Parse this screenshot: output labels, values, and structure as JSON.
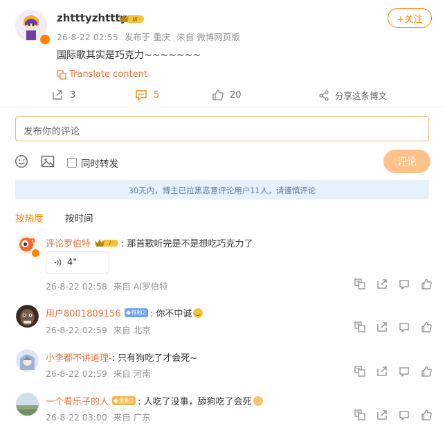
{
  "post": {
    "username": "zhtttyzhttty",
    "badge_level": "III",
    "timestamp": "26-8-22 02:55",
    "published_at_label": "发布于 重庆",
    "source_label": "来自 微博网页版",
    "content": "国际歌其实是巧克力~~~~~~~",
    "translate_label": "Translate content",
    "follow_label": "+关注",
    "repost_count": "3",
    "comment_count": "5",
    "like_count": "20",
    "share_label": "分享这条博文"
  },
  "composer": {
    "placeholder": "发布你的评论",
    "repost_checkbox_label": "同时转发",
    "submit_label": "评论"
  },
  "notice": "30天内，博主已拉黑恶意评论用户11人，请谨慎评论",
  "sort_tabs": [
    {
      "label": "按热度",
      "active": true
    },
    {
      "label": "按时间",
      "active": false
    }
  ],
  "comments": [
    {
      "username": "评论罗伯特",
      "badge": "crown-I",
      "text": ": 那首歌听完是不是想吃巧克力了",
      "voice_label": "4\"",
      "timestamp": "26-8-22 02:58",
      "source": "来自 AI罗伯特"
    },
    {
      "username": "用户8001809156",
      "badge_text": "铁粉2",
      "text": ": 你不中诚",
      "timestamp": "26-8-22 02:59",
      "source": "来自 北京"
    },
    {
      "username": "小李都不讲道理-",
      "text": ": 只有狗吃了才会死~",
      "timestamp": "26-8-22 02:59",
      "source": "来自 河南"
    },
    {
      "username": "一个看乐子的人",
      "badge_text": "金粉2",
      "text": ": 人吃了没事，舔狗吃了会死",
      "timestamp": "26-8-22 03:00",
      "source": "来自 广东"
    }
  ],
  "colors": {
    "accent": "#ff8200",
    "username": "#eb7340",
    "notice_bg": "#e7f1fb",
    "notice_text": "#5c7ea8",
    "submit_bg": "#ffc28a"
  }
}
